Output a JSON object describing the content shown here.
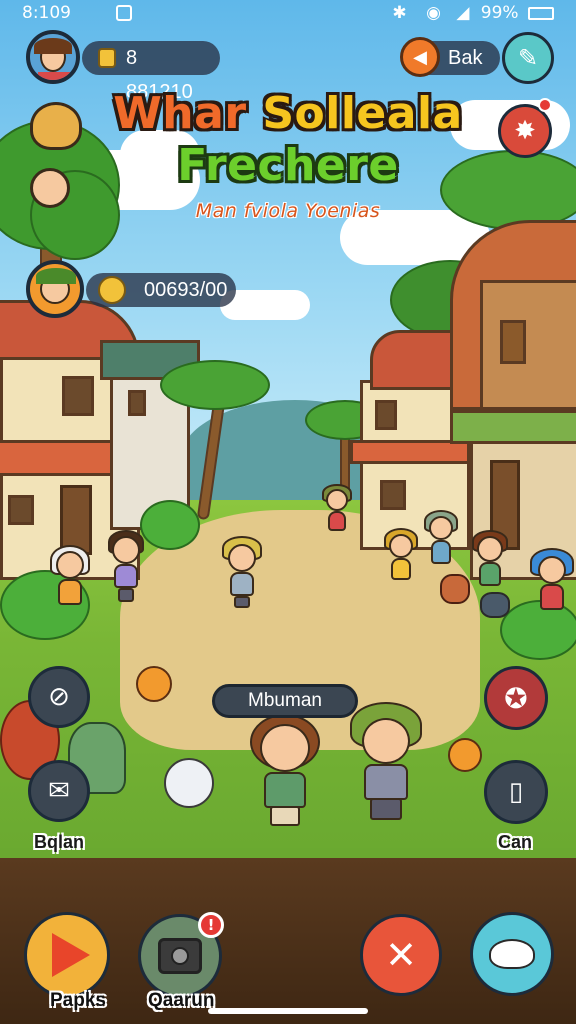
{
  "status_bar": {
    "time": "8:109",
    "battery": "99%"
  },
  "hud": {
    "currency_value": "8 881210",
    "back_label": "Bak",
    "secondary_value": "00693/00"
  },
  "title": {
    "line1_part1": "Whar",
    "line1_part2": "Solleala",
    "line2": "Frechere",
    "subtitle": "Man fviola Yoenias"
  },
  "npc": {
    "name_label": "Mbuman"
  },
  "side_buttons": {
    "left_bottom_label": "Bqlan",
    "right_bottom_label": "Can"
  },
  "bottom_bar": {
    "play_label": "Papks",
    "camera_label": "Qaarun",
    "camera_badge": "!"
  },
  "colors": {
    "sky": "#8fd3f2",
    "grass": "#79b636",
    "title_orange": "#f06a2a",
    "title_yellow": "#f6c51f",
    "title_green": "#6ccf2c",
    "badge_red": "#e53935"
  },
  "icons": {
    "top_left_avatar": "player-avatar-icon",
    "coin": "coin-icon",
    "back": "back-arrow-icon",
    "edit": "pencil-icon",
    "settings": "gear-icon",
    "play": "play-triangle-icon",
    "camera": "camera-icon",
    "close": "close-x-icon",
    "bird": "bird-icon"
  }
}
